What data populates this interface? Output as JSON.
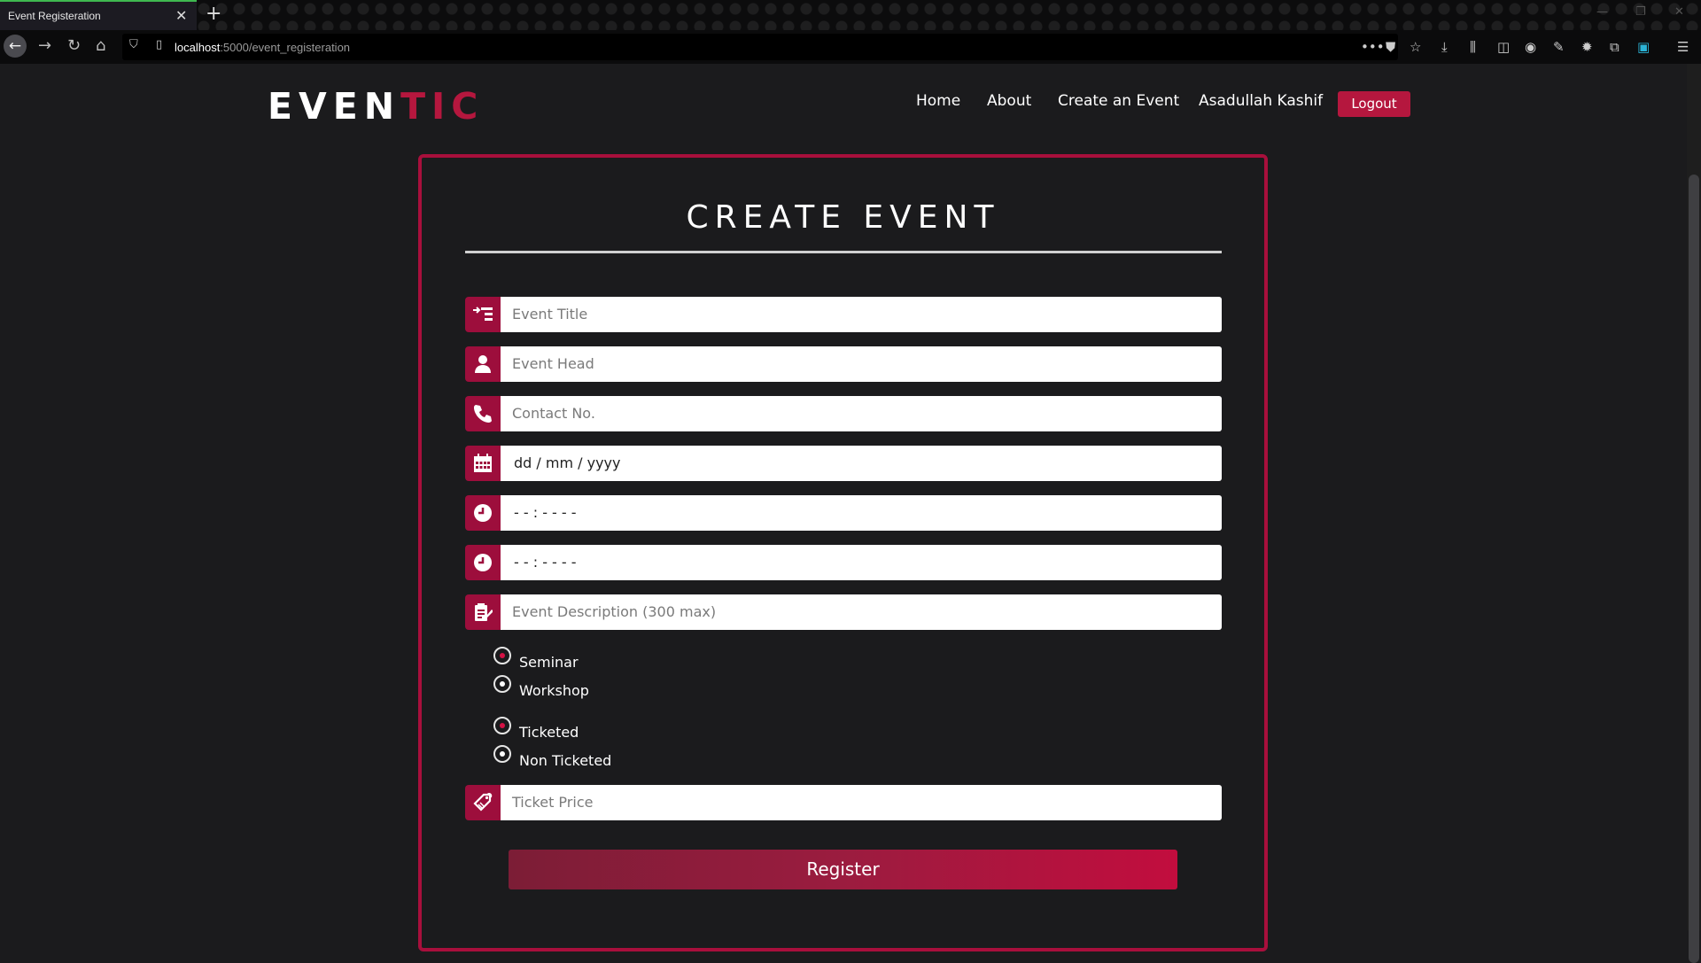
{
  "browser": {
    "tab_title": "Event Registeration",
    "url_host": "localhost",
    "url_path": ":5000/event_registeration"
  },
  "nav": {
    "logo_left": "EVEN",
    "logo_right": "TIC",
    "links": [
      "Home",
      "About",
      "Create an Event",
      "Asadullah Kashif"
    ],
    "logout": "Logout"
  },
  "form": {
    "title": "CREATE EVENT",
    "event_title_placeholder": "Event Title",
    "event_head_placeholder": "Event Head",
    "contact_placeholder": "Contact No.",
    "date_value": "dd / mm / yyyy",
    "start_time_value": "- - : - -   - -",
    "end_time_value": "- - : - -   - -",
    "description_placeholder": "Event Description (300 max)",
    "event_types": [
      "Seminar",
      "Workshop"
    ],
    "ticket_types": [
      "Ticketed",
      "Non Ticketed"
    ],
    "ticket_price_placeholder": "Ticket Price",
    "register_label": "Register"
  },
  "colors": {
    "accent": "#b5173e",
    "background": "#1b1b1d"
  }
}
